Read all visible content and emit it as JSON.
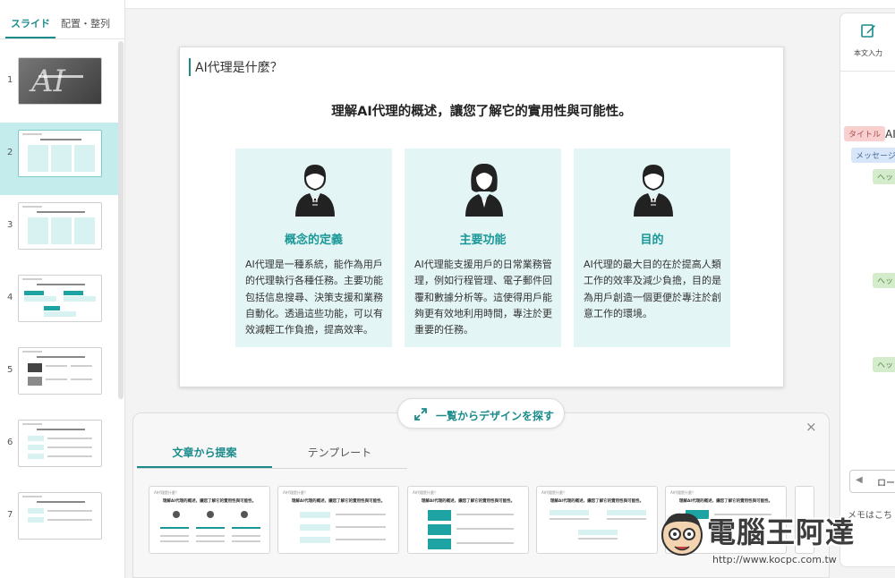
{
  "left_panel": {
    "tabs": [
      {
        "label": "スライド",
        "active": true
      },
      {
        "label": "配置・整列",
        "active": false
      }
    ],
    "slides": [
      {
        "number": "1",
        "active": false
      },
      {
        "number": "2",
        "active": true
      },
      {
        "number": "3",
        "active": false
      },
      {
        "number": "4",
        "active": false
      },
      {
        "number": "5",
        "active": false
      },
      {
        "number": "6",
        "active": false
      },
      {
        "number": "7",
        "active": false
      }
    ]
  },
  "slide": {
    "title": "AI代理是什麼？",
    "heading": "理解AI代理的概述，讓您了解它的實用性與可能性。",
    "cards": [
      {
        "title": "概念的定義",
        "icon": "businessman-icon",
        "text": "AI代理是一種系統，能作為用戶的代理執行各種任務。主要功能包括信息搜尋、決策支援和業務自動化。透過這些功能，可以有效減輕工作負擔，提高效率。"
      },
      {
        "title": "主要功能",
        "icon": "businesswoman-icon",
        "text": "AI代理能支援用戶的日常業務管理，例如行程管理、電子郵件回覆和數據分析等。這使得用戶能夠更有效地利用時間，專注於更重要的任務。"
      },
      {
        "title": "目的",
        "icon": "businessman-icon",
        "text": "AI代理的最大目的在於提高人類工作的效率及減少負擔，目的是為用戶創造一個更便於專注於創意工作的環境。"
      }
    ]
  },
  "right_panel": {
    "edit_label": "本文入力",
    "tag_title": "タイトル",
    "tag_title_value": "AI",
    "tag_message": "メッセージ",
    "tag_heading": "ヘッ",
    "scroll_arrow": "◀",
    "scroll_text": "ロー",
    "memo": "メモはこち"
  },
  "bottom_panel": {
    "explore_label": "一覧からデザインを探す",
    "close": "×",
    "tabs": [
      {
        "label": "文章から提案",
        "active": true
      },
      {
        "label": "テンプレート",
        "active": false
      }
    ],
    "suggestion_title": "AI代理是什麼？",
    "suggestion_heading": "理解AI代理的概述，讓您了解它的實用性與可能性。"
  },
  "watermark": {
    "text": "電腦王阿達",
    "url": "http://www.kocpc.com.tw"
  },
  "colors": {
    "accent": "#1a8b8b",
    "card_bg": "#e4f5f5",
    "active_thumb_bg": "#c5ecec"
  }
}
